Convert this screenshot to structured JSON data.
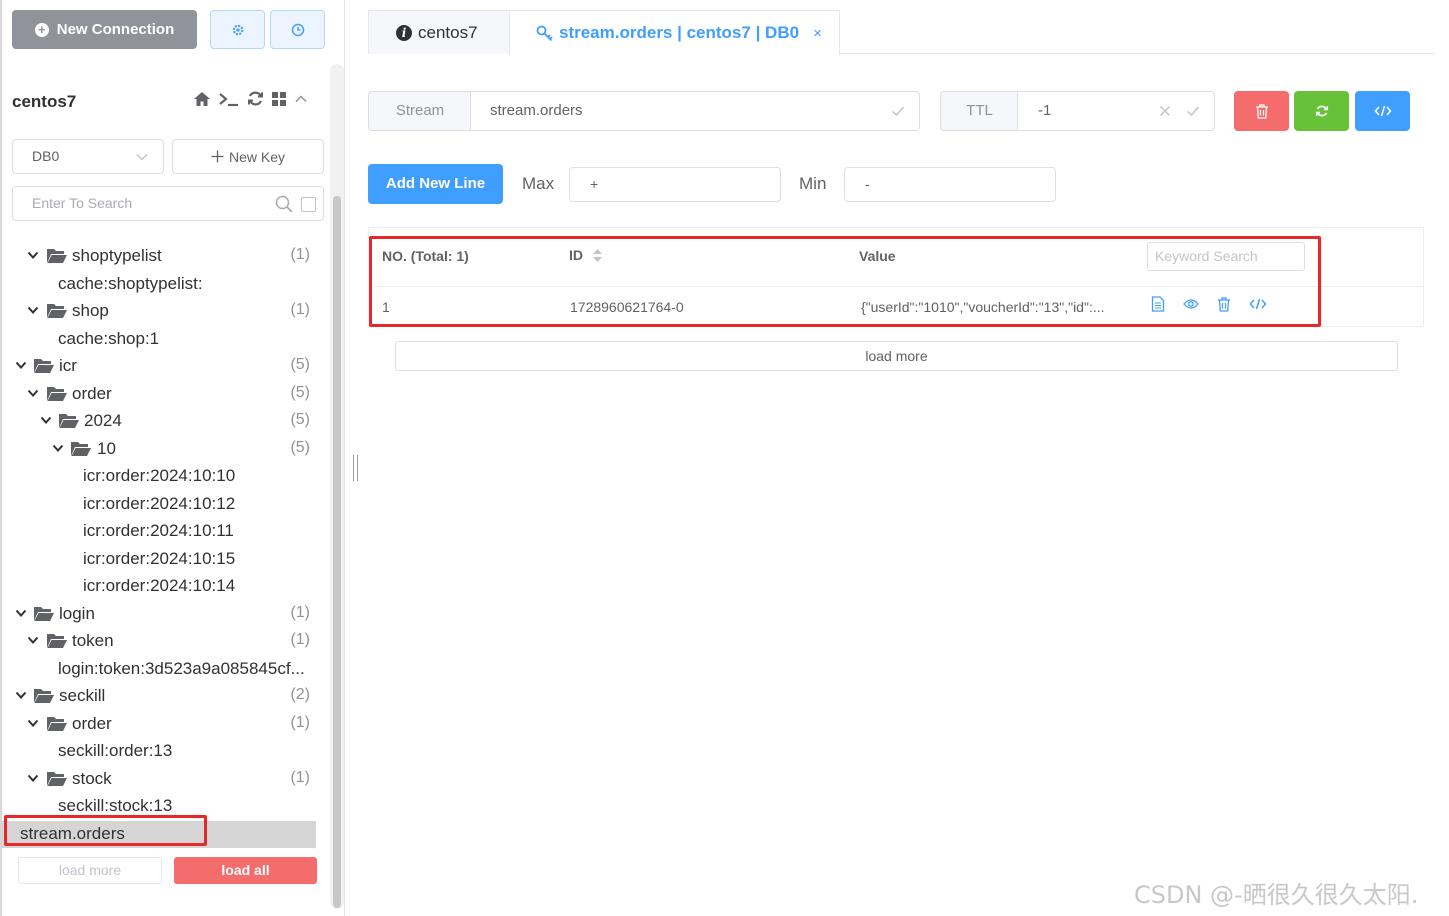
{
  "sidebar": {
    "new_connection_label": "New Connection",
    "connection_name": "centos7",
    "db_select_value": "DB0",
    "new_key_label": "New Key",
    "search_placeholder": "Enter To Search",
    "tree": [
      {
        "label": "shoptypelist",
        "count": "(1)",
        "type": "folder",
        "level": 1
      },
      {
        "label": "cache:shoptypelist:",
        "count": "",
        "type": "key",
        "level": 2
      },
      {
        "label": "shop",
        "count": "(1)",
        "type": "folder",
        "level": 1
      },
      {
        "label": "cache:shop:1",
        "count": "",
        "type": "key",
        "level": 2
      },
      {
        "label": "icr",
        "count": "(5)",
        "type": "folder",
        "level": 0
      },
      {
        "label": "order",
        "count": "(5)",
        "type": "folder",
        "level": 1
      },
      {
        "label": "2024",
        "count": "(5)",
        "type": "folder",
        "level": 2
      },
      {
        "label": "10",
        "count": "(5)",
        "type": "folder",
        "level": 3
      },
      {
        "label": "icr:order:2024:10:10",
        "count": "",
        "type": "key",
        "level": 4
      },
      {
        "label": "icr:order:2024:10:12",
        "count": "",
        "type": "key",
        "level": 4
      },
      {
        "label": "icr:order:2024:10:11",
        "count": "",
        "type": "key",
        "level": 4
      },
      {
        "label": "icr:order:2024:10:15",
        "count": "",
        "type": "key",
        "level": 4
      },
      {
        "label": "icr:order:2024:10:14",
        "count": "",
        "type": "key",
        "level": 4
      },
      {
        "label": "login",
        "count": "(1)",
        "type": "folder",
        "level": 0
      },
      {
        "label": "token",
        "count": "(1)",
        "type": "folder",
        "level": 1
      },
      {
        "label": "login:token:3d523a9a085845cf...",
        "count": "",
        "type": "key",
        "level": 2
      },
      {
        "label": "seckill",
        "count": "(2)",
        "type": "folder",
        "level": 0
      },
      {
        "label": "order",
        "count": "(1)",
        "type": "folder",
        "level": 1
      },
      {
        "label": "seckill:order:13",
        "count": "",
        "type": "key",
        "level": 2
      },
      {
        "label": "stock",
        "count": "(1)",
        "type": "folder",
        "level": 1
      },
      {
        "label": "seckill:stock:13",
        "count": "",
        "type": "key",
        "level": 2
      },
      {
        "label": "stream.orders",
        "count": "",
        "type": "key",
        "level": 0,
        "selected": true
      }
    ],
    "load_more_label": "load more",
    "load_all_label": "load all"
  },
  "tabs": [
    {
      "label": "centos7",
      "icon": "info-icon",
      "active": false
    },
    {
      "label": "stream.orders | centos7 | DB0",
      "icon": "key-icon",
      "active": true,
      "close": "×"
    }
  ],
  "key_header": {
    "type_label": "Stream",
    "key_name": "stream.orders",
    "ttl_label": "TTL",
    "ttl_value": "-1"
  },
  "stream_controls": {
    "add_new_line_label": "Add New Line",
    "max_label": "Max",
    "max_value": "+",
    "min_label": "Min",
    "min_value": "-"
  },
  "table": {
    "headers": {
      "no": "NO. (Total: 1)",
      "id": "ID",
      "value": "Value"
    },
    "keyword_placeholder": "Keyword Search",
    "rows": [
      {
        "no": "1",
        "id": "1728960621764-0",
        "value": "{\"userId\":\"1010\",\"voucherId\":\"13\",\"id\":..."
      }
    ],
    "load_more_label": "load more"
  },
  "colors": {
    "primary": "#409eff",
    "danger": "#f56c6c",
    "success": "#67c23a",
    "info": "#909399",
    "highlight": "#e62828"
  },
  "watermark": "CSDN @-晒很久很久太阳."
}
